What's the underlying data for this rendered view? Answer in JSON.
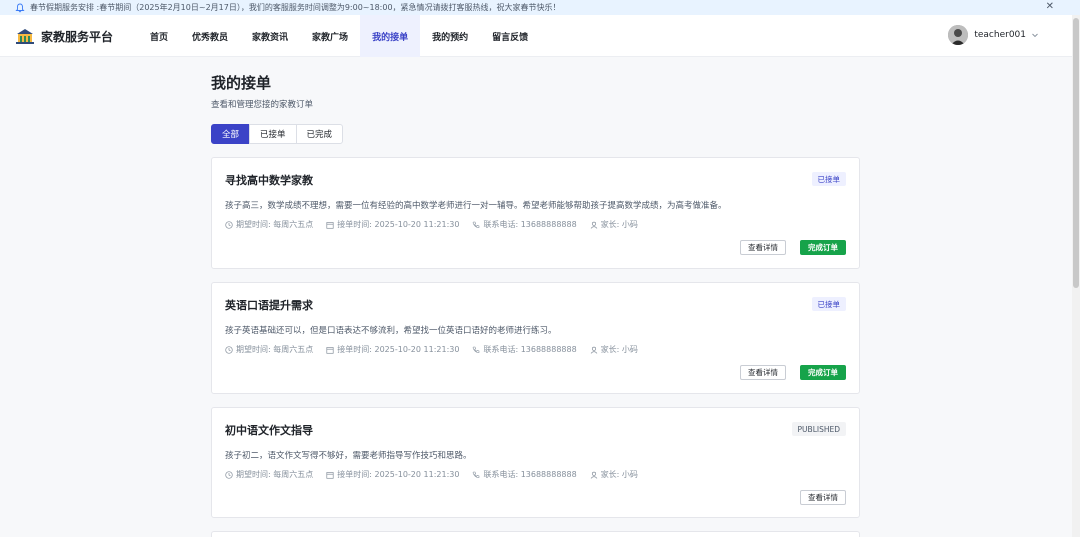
{
  "notice": {
    "text": "春节假期服务安排 :春节期间（2025年2月10日~2月17日），我们的客服服务时间调整为9:00~18:00，紧急情况请拨打客服热线，祝大家春节快乐！"
  },
  "header": {
    "brand": "家教服务平台",
    "nav": [
      "首页",
      "优秀教员",
      "家教资讯",
      "家教广场",
      "我的接单",
      "我的预约",
      "留言反馈"
    ],
    "active_nav": "我的接单",
    "username": "teacher001"
  },
  "page": {
    "title": "我的接单",
    "subtitle": "查看和管理您接的家教订单",
    "tabs": [
      "全部",
      "已接单",
      "已完成"
    ],
    "active_tab": "全部"
  },
  "orders": [
    {
      "title": "寻找高中数学家教",
      "status": "已接单",
      "desc": "孩子高三，数学成绩不理想，需要一位有经验的高中数学老师进行一对一辅导。希望老师能够帮助孩子提高数学成绩，为高考做准备。",
      "time": "期望时间: 每周六五点",
      "accepted": "接单时间: 2025-10-20 11:21:30",
      "phone": "联系电话: 13688888888",
      "parent": "家长: 小码",
      "detail_label": "查看详情",
      "complete_label": "完成订单"
    },
    {
      "title": "英语口语提升需求",
      "status": "已接单",
      "desc": "孩子英语基础还可以，但是口语表达不够流利，希望找一位英语口语好的老师进行练习。",
      "time": "期望时间: 每周六五点",
      "accepted": "接单时间: 2025-10-20 11:21:30",
      "phone": "联系电话: 13688888888",
      "parent": "家长: 小码",
      "detail_label": "查看详情",
      "complete_label": "完成订单"
    },
    {
      "title": "初中语文作文指导",
      "status": "PUBLISHED",
      "desc": "孩子初二，语文作文写得不够好，需要老师指导写作技巧和思路。",
      "time": "期望时间: 每周六五点",
      "accepted": "接单时间: 2025-10-20 11:21:30",
      "phone": "联系电话: 13688888888",
      "parent": "家长: 小码",
      "detail_label": "查看详情"
    }
  ]
}
